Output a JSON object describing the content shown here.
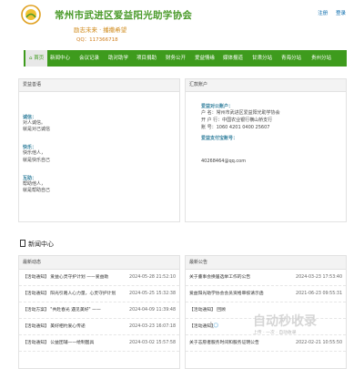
{
  "header": {
    "title": "常州市武进区爱益阳光助学协会",
    "slogan": "励志未来 · 播撒希望",
    "qq": "QQ：117366718",
    "links": [
      "注册",
      "登录"
    ]
  },
  "nav": {
    "items": [
      "首页",
      "新闻中心",
      "会议记录",
      "助对助学",
      "项目捐助",
      "财务公开",
      "爱益情缘",
      "媒体报道",
      "甘肃分站",
      "青海分站",
      "贵州分站"
    ]
  },
  "left": {
    "head": "爱益善语",
    "sections": [
      {
        "title": "诚信：",
        "lines": [
          "对人诚信。",
          "就是对己诚信"
        ]
      },
      {
        "title": "快乐：",
        "lines": [
          "快乐他人，",
          "就是快乐自己"
        ]
      },
      {
        "title": "互助：",
        "lines": [
          "帮助他人，",
          "就是帮助自己"
        ]
      }
    ]
  },
  "right": {
    "head": "汇款账户",
    "account_title": "爱益对公账户：",
    "lines": [
      "户  名：常州市武进区爱益阳光助学协会",
      "开 户 行：中国农业银行横山桥支行",
      "账  号：1060 4201 0400 25607"
    ],
    "alipay_title": "爱益支付宝账号：",
    "email": "40268464@qq.com"
  },
  "news": {
    "title": "新闻中心",
    "left_head": "最新动态",
    "right_head": "最新公告",
    "left_rows": [
      {
        "title": "【活动通知】 爱益心灵守护计划 ——爱益助",
        "date": "2024-05-28 21:52:10"
      },
      {
        "title": "【活动通知】 阳光引路人心力量，心灵守护计划",
        "date": "2024-05-25 15:32:38"
      },
      {
        "title": "【活动方案】 \"共赴春光 遇见美好\" ——",
        "date": "2024-04-09 11:39:48"
      },
      {
        "title": "【活动通知】 美好相约爱心传递",
        "date": "2024-03-23 16:07:18"
      },
      {
        "title": "【活动通知】 公益团辅——绘制图具",
        "date": "2024-03-02 15:57:58"
      }
    ],
    "right_rows": [
      {
        "title": "关于董事会换届选举工作的公告",
        "date": "2024-03-23 17:53:40"
      },
      {
        "title": "爱益阳光助学协会会员资格审核请示函",
        "date": "2021-06-23 09:55:31"
      },
      {
        "title": "【活动通知】 回顾",
        "date": ""
      },
      {
        "title": "【活动通知】 ",
        "date": ""
      },
      {
        "title": "关于志愿者服务时间和服务证明公告",
        "date": "2022-02-21 10:55:50"
      }
    ]
  },
  "watermark": {
    "text": "自动秒收录",
    "sub": "上传 · 一次 · 自动收录"
  },
  "colors": {
    "brand_green": "#3e9b1d",
    "link_blue": "#0066aa",
    "accent_orange": "#d08a1a"
  }
}
